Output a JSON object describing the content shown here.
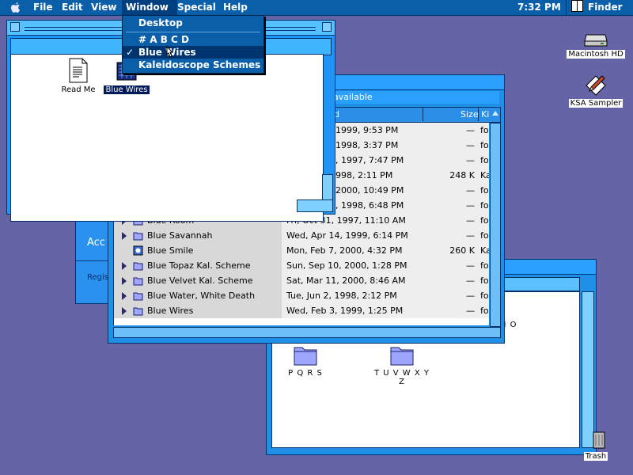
{
  "menubar": {
    "items": [
      "File",
      "Edit",
      "View",
      "Window",
      "Special",
      "Help"
    ],
    "clock": "7:32 PM",
    "app": "Finder"
  },
  "window_menu": {
    "items": [
      {
        "label": "Desktop",
        "checked": false
      },
      {
        "label": "# A B C D",
        "checked": false
      },
      {
        "label": "Blue Wires",
        "checked": true
      },
      {
        "label": "Kaleidoscope Schemes",
        "checked": false
      }
    ],
    "checkmark": "✓"
  },
  "front_window": {
    "icons": [
      {
        "label": "Read Me",
        "icon": "document-icon"
      },
      {
        "label": "Blue Wires",
        "icon": "app-icon"
      }
    ]
  },
  "registration_window": {
    "fragment1": "Acc",
    "fragment2": "Regis"
  },
  "list_window": {
    "info_fragment": "available",
    "columns": {
      "date_fragment": "d",
      "size": "Size",
      "kind_fragment": "Ki"
    },
    "rows_partial": [
      {
        "date": "1999, 9:53 PM",
        "size": "—",
        "kind": "fol"
      },
      {
        "date": "1998, 3:37 PM",
        "size": "—",
        "kind": "fol"
      },
      {
        "date": ", 1997, 7:47 PM",
        "size": "—",
        "kind": "fol"
      },
      {
        "date": "998, 2:11 PM",
        "size": "248 K",
        "kind": "Ka"
      },
      {
        "date": "2000, 10:49 PM",
        "size": "—",
        "kind": "fol"
      },
      {
        "date": ", 1998, 6:48 PM",
        "size": "—",
        "kind": "fol"
      }
    ],
    "rows": [
      {
        "name": "Blue Room",
        "date": "Fri, Oct 31, 1997, 11:10 AM",
        "size": "—",
        "kind": "fol",
        "folder": true
      },
      {
        "name": "Blue Savannah",
        "date": "Wed, Apr 14, 1999, 6:14 PM",
        "size": "—",
        "kind": "fol",
        "folder": true
      },
      {
        "name": "Blue Smile",
        "date": "Mon, Feb 7, 2000, 4:32 PM",
        "size": "260 K",
        "kind": "Ka",
        "folder": false
      },
      {
        "name": "Blue Topaz Kal. Scheme",
        "date": "Sun, Sep 10, 2000, 1:28 PM",
        "size": "—",
        "kind": "fol",
        "folder": true
      },
      {
        "name": "Blue Velvet Kal. Scheme",
        "date": "Sat, Mar 11, 2000, 8:46 AM",
        "size": "—",
        "kind": "fol",
        "folder": true
      },
      {
        "name": "Blue Water, White Death",
        "date": "Tue, Jun 2, 1998, 2:12 PM",
        "size": "—",
        "kind": "fol",
        "folder": true
      },
      {
        "name": "Blue Wires",
        "date": "Wed, Feb 3, 1999, 1:25 PM",
        "size": "—",
        "kind": "fol",
        "folder": true
      }
    ]
  },
  "back_window": {
    "folders": [
      {
        "label": "P Q R S"
      },
      {
        "label": "T U V W X Y Z"
      }
    ],
    "fragment": "N O"
  },
  "desktop": {
    "icons": [
      {
        "label": "Macintosh HD",
        "icon": "hard-drive-icon"
      },
      {
        "label": "KSA Sampler",
        "icon": "pen-document-icon"
      },
      {
        "label": "Trash",
        "icon": "trash-icon"
      }
    ]
  },
  "colors": {
    "desktop": "#6464a6",
    "menubar": "#0a5fa8",
    "window_frame": "#1f8fe8",
    "selection": "#001a5a"
  }
}
